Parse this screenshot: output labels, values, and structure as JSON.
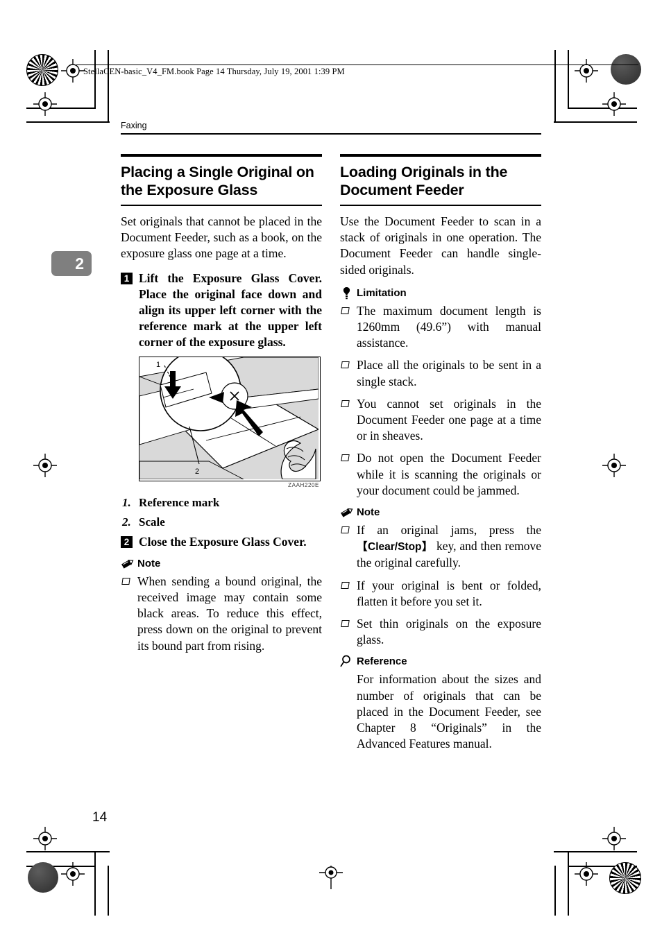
{
  "banner": {
    "text": "StellaCEN-basic_V4_FM.book  Page 14  Thursday, July 19, 2001  1:39 PM"
  },
  "page": {
    "running_head": "Faxing",
    "chapter_tab": "2",
    "folio": "14"
  },
  "left_column": {
    "title": "Placing a Single Original on the Exposure Glass",
    "intro": "Set originals that cannot be placed in the Document Feeder, such as a book, on the exposure glass one page at a time.",
    "steps": [
      {
        "num": "1",
        "text": "Lift the Exposure Glass Cover. Place the original face down and align its upper left corner with the reference mark at the upper left corner of the exposure glass."
      },
      {
        "num": "2",
        "text": "Close the Exposure Glass Cover."
      }
    ],
    "figure": {
      "code": "ZAAH220E",
      "callout_1": "1",
      "callout_2": "2"
    },
    "legend": [
      {
        "num": "1.",
        "label": "Reference mark"
      },
      {
        "num": "2.",
        "label": "Scale"
      }
    ],
    "note": {
      "icon": "pencil-icon",
      "heading": "Note",
      "items": [
        "When sending a bound original, the received image may contain some black areas. To reduce this effect, press down on the original to prevent its bound part from rising."
      ]
    }
  },
  "right_column": {
    "title": "Loading Originals in the Document Feeder",
    "intro": "Use the Document Feeder to scan in a stack of originals in one operation. The Document Feeder can handle single-sided originals.",
    "limitation": {
      "icon": "bulb-icon",
      "heading": "Limitation",
      "items": [
        "The maximum document length is 1260mm (49.6”) with manual assistance.",
        "Place all the originals to be sent in a single stack.",
        "You cannot set originals in the Document Feeder one page at a time or in sheaves.",
        "Do not open the Document Feeder while it is scanning the originals or your document could be jammed."
      ]
    },
    "note": {
      "icon": "pencil-icon",
      "heading": "Note",
      "items_pre": "If an original jams, press the ",
      "keycap": "【Clear/Stop】",
      "items_post": " key, and then remove the original carefully.",
      "items": [
        "If your original is bent or folded, flatten it before you set it.",
        "Set thin originals on the exposure glass."
      ]
    },
    "reference": {
      "icon": "magnifier-icon",
      "heading": "Reference",
      "text": "For information about the sizes and number of originals that can be placed in the Document Feeder, see Chapter 8 “Originals” in the Advanced Features manual."
    }
  },
  "colors": {
    "text": "#000000",
    "tab_gray": "#7f7f7f",
    "figure_gray": "#d9d9d9",
    "mark_gray": "#4a4a4a"
  }
}
